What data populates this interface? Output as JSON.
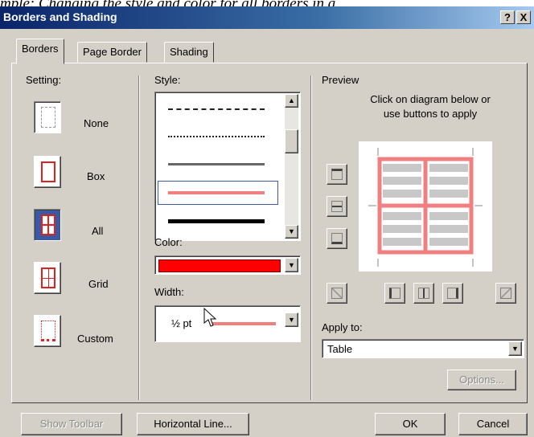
{
  "caption": "mple: Changing the style and color for all borders in a",
  "window": {
    "title": "Borders and Shading",
    "help_glyph": "?",
    "close_glyph": "X"
  },
  "tabs": [
    {
      "label": "Borders",
      "active": true
    },
    {
      "label": "Page Border",
      "active": false
    },
    {
      "label": "Shading",
      "active": false
    }
  ],
  "setting": {
    "label": "Setting:",
    "options": [
      {
        "label": "None",
        "selected": false
      },
      {
        "label": "Box",
        "selected": false
      },
      {
        "label": "All",
        "selected": true
      },
      {
        "label": "Grid",
        "selected": false
      },
      {
        "label": "Custom",
        "selected": false
      }
    ]
  },
  "style": {
    "label": "Style:",
    "lines": [
      "dash-dot",
      "dotted",
      "single",
      "single-selected",
      "thick"
    ],
    "selected_index": 3
  },
  "color": {
    "label": "Color:",
    "value": "#ff0000"
  },
  "width": {
    "label": "Width:",
    "value": "½ pt"
  },
  "preview": {
    "label": "Preview",
    "instruction_line1": "Click on diagram below or",
    "instruction_line2": "use buttons to apply",
    "border_color": "#f08080"
  },
  "apply_to": {
    "label": "Apply to:",
    "value": "Table"
  },
  "buttons": {
    "options": "Options...",
    "show_toolbar": "Show Toolbar",
    "horizontal_line": "Horizontal Line...",
    "ok": "OK",
    "cancel": "Cancel"
  },
  "colors": {
    "face": "#d4d0c8",
    "title_start": "#0a246a",
    "selected": "#3a5aa5",
    "accent": "#ff0000"
  }
}
